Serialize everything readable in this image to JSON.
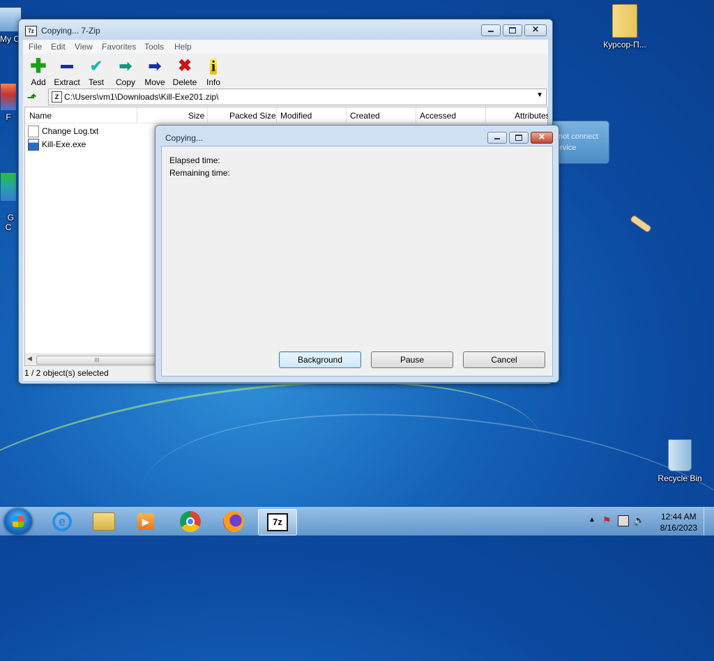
{
  "desktop": {
    "icons": [
      {
        "label": "My C"
      },
      {
        "label": "F"
      },
      {
        "label": "G\nC"
      },
      {
        "label": "Курсор-П..."
      },
      {
        "label": "Recycle Bin"
      }
    ]
  },
  "notification": {
    "line1": "not connect",
    "line2": "ervice"
  },
  "main_window": {
    "title": "Copying... 7-Zip",
    "menu": [
      "File",
      "Edit",
      "View",
      "Favorites",
      "Tools",
      "Help"
    ],
    "toolbar": [
      {
        "label": "Add",
        "icon": "plus-icon"
      },
      {
        "label": "Extract",
        "icon": "minus-icon"
      },
      {
        "label": "Test",
        "icon": "check-icon"
      },
      {
        "label": "Copy",
        "icon": "double-arrow-icon"
      },
      {
        "label": "Move",
        "icon": "arrow-right-icon"
      },
      {
        "label": "Delete",
        "icon": "x-icon"
      },
      {
        "label": "Info",
        "icon": "info-icon"
      }
    ],
    "address": "C:\\Users\\vm1\\Downloads\\Kill-Exe201.zip\\",
    "columns": [
      "Name",
      "Size",
      "Packed Size",
      "Modified",
      "Created",
      "Accessed",
      "Attributes"
    ],
    "files": [
      {
        "name": "Change Log.txt",
        "type": "text-file-icon"
      },
      {
        "name": "Kill-Exe.exe",
        "type": "exe-file-icon"
      }
    ],
    "scroll_grip": "III",
    "status": "1 / 2 object(s) selected"
  },
  "dialog": {
    "title": "Copying...",
    "elapsed_label": "Elapsed time:",
    "remaining_label": "Remaining time:",
    "buttons": {
      "background": "Background",
      "pause": "Pause",
      "cancel": "Cancel"
    }
  },
  "taskbar": {
    "apps": [
      "internet-explorer-icon",
      "file-explorer-icon",
      "media-player-icon",
      "chrome-icon",
      "firefox-icon",
      "7zip-icon"
    ],
    "zip_label": "7z",
    "clock_time": "12:44 AM",
    "clock_date": "8/16/2023"
  },
  "colors": {
    "accent": "#1563b8",
    "delete": "#d01010",
    "add": "#19a019"
  }
}
